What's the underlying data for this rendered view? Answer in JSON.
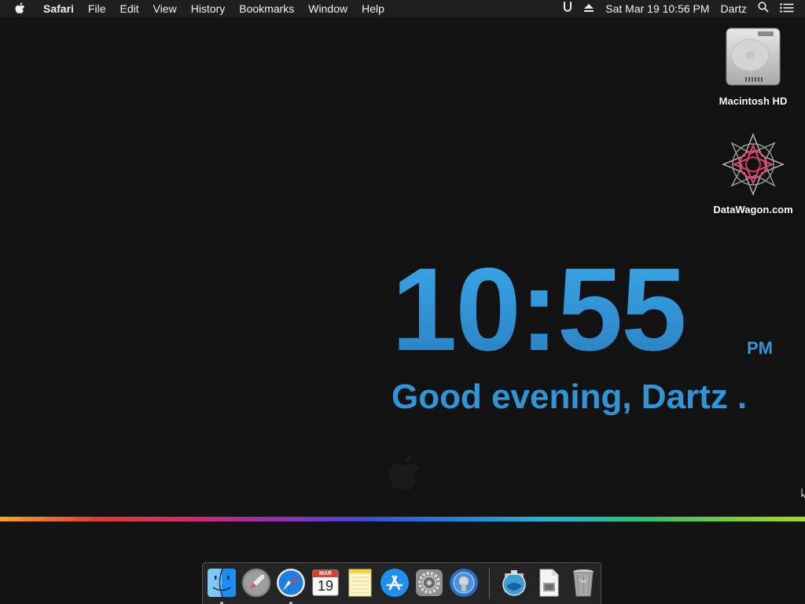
{
  "menubar": {
    "app_name": "Safari",
    "items": [
      "File",
      "Edit",
      "View",
      "History",
      "Bookmarks",
      "Window",
      "Help"
    ],
    "clock": "Sat Mar 19  10:56 PM",
    "user": "Dartz",
    "status_icons": [
      "accessibility-icon",
      "eject-icon",
      "spotlight-icon",
      "notification-center-icon"
    ]
  },
  "desktop": {
    "icons": [
      {
        "label": "Macintosh HD",
        "icon": "hard-drive-icon"
      },
      {
        "label": "DataWagon.com",
        "icon": "datawagon-logo-icon"
      }
    ]
  },
  "widget": {
    "time": "10:55",
    "ampm": "PM",
    "greeting": "Good evening, Dartz ."
  },
  "dock": {
    "apps": [
      {
        "name": "finder",
        "icon": "finder-icon",
        "running": true
      },
      {
        "name": "launchpad",
        "icon": "launchpad-icon",
        "running": false
      },
      {
        "name": "safari",
        "icon": "safari-icon",
        "running": true
      },
      {
        "name": "calendar",
        "icon": "calendar-icon",
        "running": false,
        "badge_month": "MAR",
        "badge_day": "19"
      },
      {
        "name": "notes",
        "icon": "notes-icon",
        "running": false
      },
      {
        "name": "app-store",
        "icon": "app-store-icon",
        "running": false
      },
      {
        "name": "system-preferences",
        "icon": "gear-icon",
        "running": false
      },
      {
        "name": "utility",
        "icon": "utility-icon",
        "running": false
      }
    ],
    "docs": [
      {
        "name": "downloads",
        "icon": "downloads-stack-icon"
      },
      {
        "name": "document",
        "icon": "document-icon"
      },
      {
        "name": "trash",
        "icon": "trash-icon"
      }
    ]
  },
  "colors": {
    "accent": "#2f95d6",
    "menubar_bg": "#1f1f1f",
    "desktop_bg": "#121212"
  }
}
